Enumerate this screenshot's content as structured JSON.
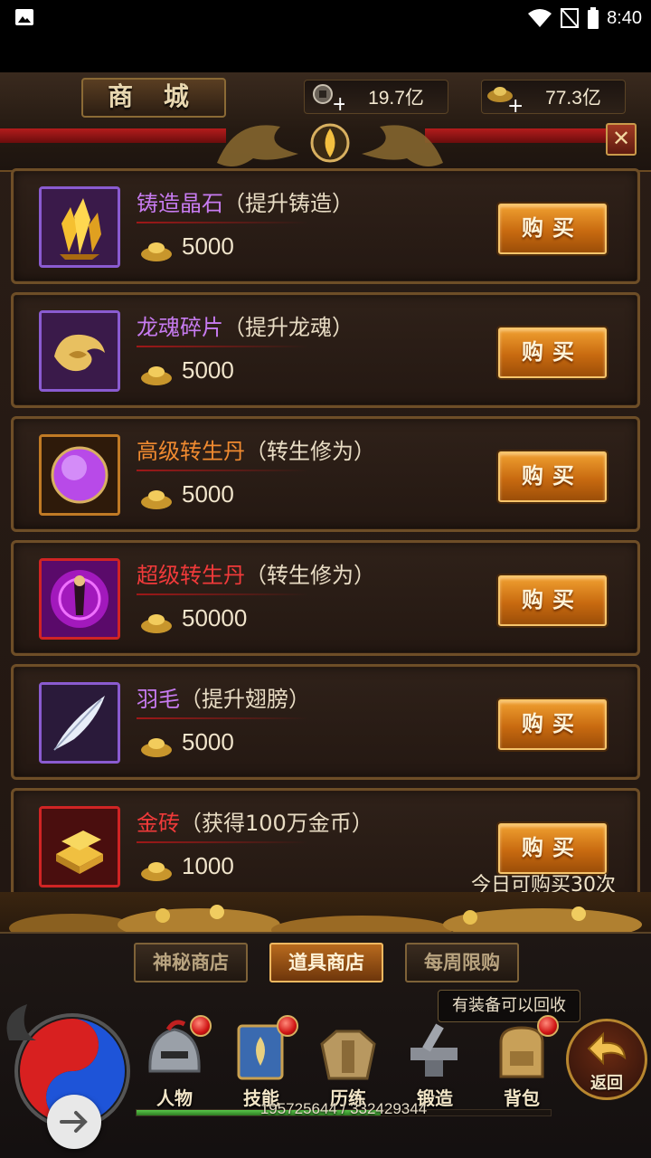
{
  "status_bar": {
    "time": "8:40"
  },
  "header": {
    "title": "商 城",
    "currency_coin": "19.7亿",
    "currency_gold": "77.3亿"
  },
  "items": [
    {
      "name": "铸造晶石",
      "desc": "（提升铸造）",
      "price": "5000",
      "name_color": "#c77bf0",
      "icon": "crystal-icon",
      "frame": "purple"
    },
    {
      "name": "龙魂碎片",
      "desc": "（提升龙魂）",
      "price": "5000",
      "name_color": "#c77bf0",
      "icon": "dragon-soul-icon",
      "frame": "purple"
    },
    {
      "name": "高级转生丹",
      "desc": "（转生修为）",
      "price": "5000",
      "name_color": "#f08a30",
      "icon": "pill-orb-icon",
      "frame": "orange"
    },
    {
      "name": "超级转生丹",
      "desc": "（转生修为）",
      "price": "50000",
      "name_color": "#f03a3a",
      "icon": "super-pill-icon",
      "frame": "red"
    },
    {
      "name": "羽毛",
      "desc": "（提升翅膀）",
      "price": "5000",
      "name_color": "#c77bf0",
      "icon": "feather-icon",
      "frame": "purple"
    },
    {
      "name": "金砖",
      "desc": "（获得100万金币）",
      "price": "1000",
      "name_color": "#f03a3a",
      "icon": "gold-brick-icon",
      "frame": "red",
      "limit": "今日可购买30次"
    }
  ],
  "buy_label": "购买",
  "tabs": [
    {
      "label": "神秘商店",
      "active": false
    },
    {
      "label": "道具商店",
      "active": true
    },
    {
      "label": "每周限购",
      "active": false
    }
  ],
  "hint": "有装备可以回收",
  "nav": [
    {
      "label": "人物",
      "icon": "helmet-icon",
      "dot": true
    },
    {
      "label": "技能",
      "icon": "skill-book-icon",
      "dot": true
    },
    {
      "label": "历练",
      "icon": "armor-icon",
      "dot": false
    },
    {
      "label": "锻造",
      "icon": "anvil-icon",
      "dot": false
    },
    {
      "label": "背包",
      "icon": "backpack-icon",
      "dot": true
    }
  ],
  "back_label": "返回",
  "exp": {
    "text": "195725644 / 332429344",
    "fraction": 0.589
  },
  "colors": {
    "accent_orange": "#e08a20",
    "frame_gold": "#6e4e27",
    "background": "#241812"
  }
}
